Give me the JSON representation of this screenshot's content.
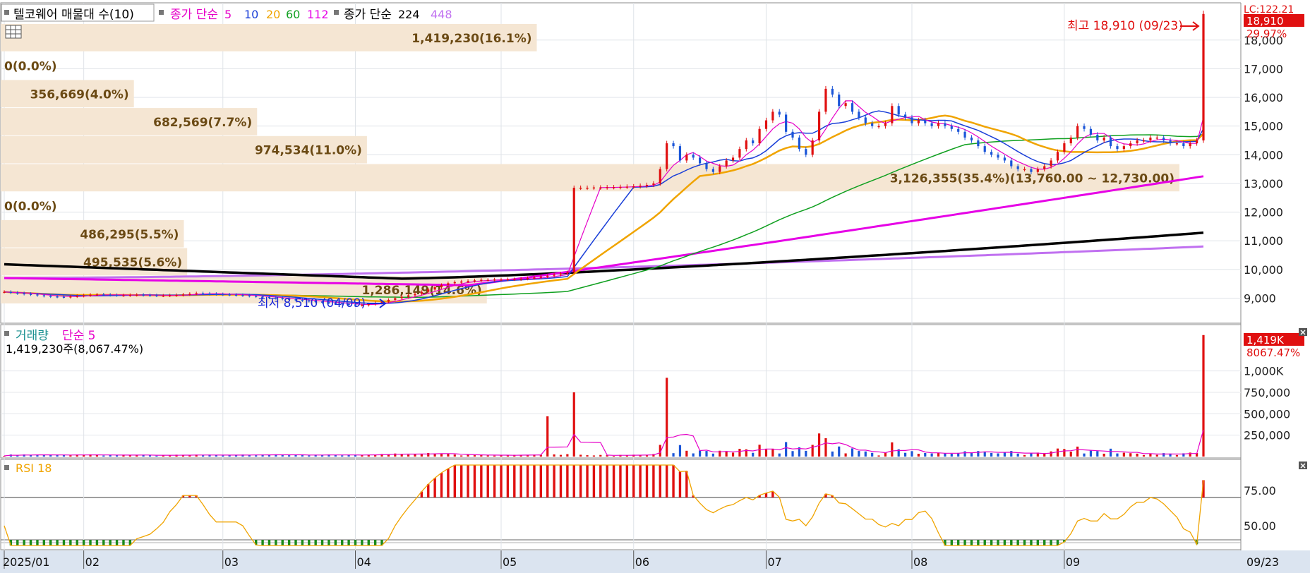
{
  "price_panel": {
    "legend": {
      "title": "텔코웨어 매물대 수(10)",
      "ma_prefix": "종가 단순",
      "ma_periods": [
        "5",
        "10",
        "20",
        "60",
        "112"
      ],
      "ma_colors": [
        "#e600c8",
        "#1a3fd8",
        "#f0a400",
        "#10a020",
        "#e600e6"
      ],
      "ma2_prefix": "종가 단순",
      "ma2_periods": [
        "224",
        "448"
      ],
      "ma2_colors": [
        "#000000",
        "#c070f0"
      ]
    },
    "right_badge": {
      "label": "LC:122.21",
      "price": "18,910",
      "pct": "29.97%"
    },
    "high_label": "최고 18,910 (09/23)",
    "low_label": "최저 8,510 (04/09)",
    "y_ticks": [
      "18,000",
      "17,000",
      "16,000",
      "15,000",
      "14,000",
      "13,000",
      "12,000",
      "11,000",
      "10,000",
      "9,000"
    ],
    "volume_profile": [
      {
        "label": "1,419,230(16.1%)"
      },
      {
        "label": "0(0.0%)"
      },
      {
        "label": "356,669(4.0%)"
      },
      {
        "label": "682,569(7.7%)"
      },
      {
        "label": "974,534(11.0%)"
      },
      {
        "label": "3,126,355(35.4%)(13,760.00 ~ 12,730.00)"
      },
      {
        "label": "0(0.0%)"
      },
      {
        "label": "486,295(5.5%)"
      },
      {
        "label": "495,535(5.6%)"
      },
      {
        "label": "1,286,149(14.6%)"
      }
    ],
    "volume_profile_bar_color": "#f5e6d3"
  },
  "volume_panel": {
    "legend_prefix": "거래량",
    "legend_ma": "단순 5",
    "legend_ma_color": "#e600c8",
    "info": "1,419,230주(8,067.47%)",
    "badge_value": "1,419K",
    "badge_pct": "8067.47%",
    "y_ticks": [
      "1,000K",
      "750,000",
      "500,000",
      "250,000"
    ]
  },
  "rsi_panel": {
    "legend": "RSI 18",
    "legend_color": "#f0a400",
    "y_ticks": [
      "75.00",
      "50.00"
    ]
  },
  "x_axis": {
    "labels": [
      "2025/01",
      "02",
      "03",
      "04",
      "05",
      "06",
      "07",
      "08",
      "09"
    ],
    "right_label": "09/23"
  },
  "chart_data": {
    "type": "candlestick",
    "title": "텔코웨어",
    "x_labels": [
      "2025/01",
      "02",
      "03",
      "04",
      "05",
      "06",
      "07",
      "08",
      "09"
    ],
    "price_ylim": [
      8200,
      19200
    ],
    "high": {
      "value": 18910,
      "date": "09/23"
    },
    "low": {
      "value": 8510,
      "date": "04/09"
    },
    "close_series": [
      9220,
      9190,
      9170,
      9150,
      9130,
      9100,
      9080,
      9060,
      9050,
      9040,
      9060,
      9080,
      9100,
      9120,
      9130,
      9120,
      9110,
      9100,
      9100,
      9110,
      9120,
      9110,
      9100,
      9090,
      9090,
      9100,
      9110,
      9130,
      9150,
      9170,
      9160,
      9150,
      9140,
      9130,
      9120,
      9110,
      9100,
      9080,
      9060,
      9040,
      9020,
      9000,
      8980,
      8960,
      8940,
      8920,
      8900,
      8880,
      8860,
      8840,
      8820,
      8800,
      8780,
      8760,
      8760,
      8790,
      8830,
      8880,
      8940,
      9000,
      9050,
      9100,
      9150,
      9220,
      9300,
      9380,
      9460,
      9520,
      9560,
      9580,
      9600,
      9620,
      9640,
      9640,
      9650,
      9650,
      9660,
      9660,
      9680,
      9700,
      9720,
      9750,
      9780,
      9820,
      9860,
      9900,
      12850,
      12850,
      12850,
      12860,
      12860,
      12870,
      12870,
      12880,
      12890,
      12900,
      12920,
      12950,
      13000,
      13500,
      14400,
      14300,
      13800,
      14000,
      13900,
      13700,
      13500,
      13400,
      13600,
      13800,
      13900,
      14200,
      14500,
      14400,
      14900,
      15200,
      15500,
      15400,
      14800,
      14600,
      14200,
      14000,
      14500,
      15500,
      16300,
      16100,
      15700,
      15800,
      15500,
      15300,
      15100,
      15000,
      15000,
      15100,
      15700,
      15400,
      15300,
      15100,
      15200,
      15100,
      15000,
      15100,
      15000,
      14900,
      14800,
      14600,
      14500,
      14300,
      14100,
      14000,
      13900,
      13800,
      13600,
      13500,
      13500,
      13400,
      13500,
      13600,
      13800,
      14100,
      14400,
      14600,
      15000,
      14900,
      14700,
      14500,
      14600,
      14300,
      14200,
      14300,
      14400,
      14500,
      14500,
      14600,
      14600,
      14500,
      14400,
      14400,
      14300,
      14400,
      14500,
      18910
    ],
    "volume_ylim": [
      0,
      1500000
    ],
    "volume_last": 1419230,
    "volume_last_pct": 8067.47,
    "volume_peaks": [
      {
        "x_label": "05",
        "value": 470000
      },
      {
        "x_label": "05",
        "value": 920000
      },
      {
        "x_label": "09/23",
        "value": 1419230
      }
    ],
    "rsi_ylim": [
      35,
      95
    ],
    "rsi_reference_line": 70,
    "rsi_last": 79,
    "volume_profile": [
      {
        "volume": 1419230,
        "pct": 16.1
      },
      {
        "volume": 0,
        "pct": 0.0
      },
      {
        "volume": 356669,
        "pct": 4.0
      },
      {
        "volume": 682569,
        "pct": 7.7
      },
      {
        "volume": 974534,
        "pct": 11.0
      },
      {
        "volume": 3126355,
        "pct": 35.4,
        "range": [
          12730,
          13760
        ]
      },
      {
        "volume": 0,
        "pct": 0.0
      },
      {
        "volume": 486295,
        "pct": 5.5
      },
      {
        "volume": 495535,
        "pct": 5.6
      },
      {
        "volume": 1286149,
        "pct": 14.6
      }
    ]
  }
}
